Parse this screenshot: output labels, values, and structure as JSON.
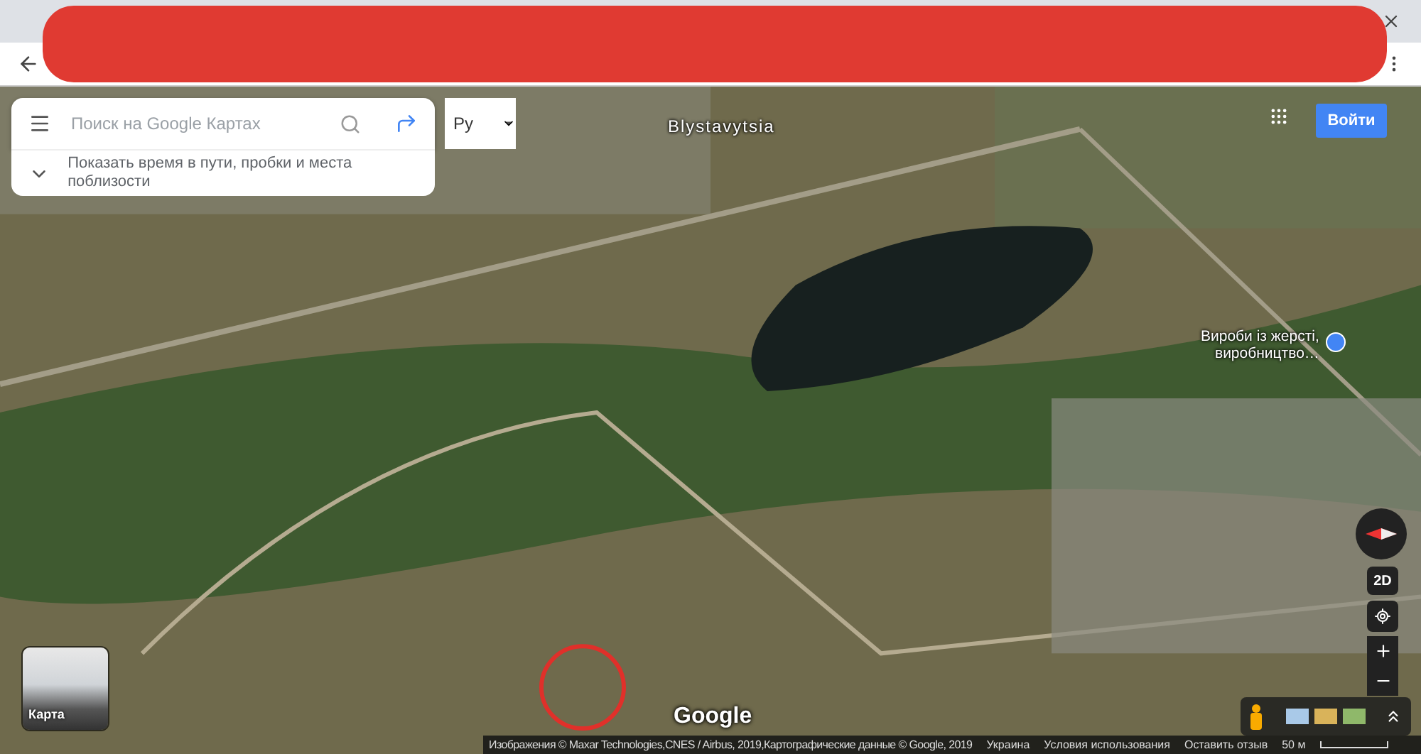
{
  "search": {
    "placeholder": "Поиск на Google Картах"
  },
  "travel_hint": "Показать время в пути, пробки и места поблизости",
  "language": {
    "value": "Ру"
  },
  "sign_in": "Войти",
  "map_labels": [
    {
      "kind": "town",
      "lines": [
        "Blystavytsia"
      ]
    },
    {
      "kind": "place",
      "lines": [
        "Вироби із жерсті,",
        "виробництво…"
      ]
    }
  ],
  "logo": "Google",
  "layer_switch": "Карта",
  "view_toggle": "2D",
  "footer": {
    "links": [
      "Изображения © Maxar Technologies,CNES / Airbus, 2019,Картографические данные © Google, 2019",
      "Украина",
      "Условия использования",
      "Оставить отзыв"
    ],
    "scale": "50 м"
  }
}
